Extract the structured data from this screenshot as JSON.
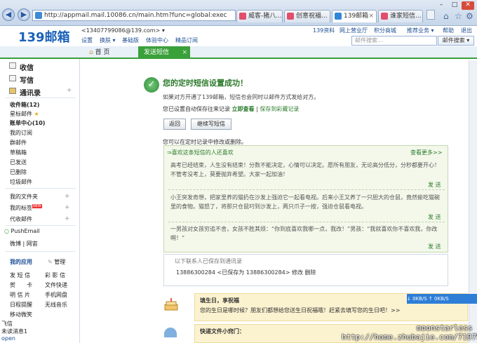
{
  "browser": {
    "url": "http://appmail.mail.10086.cn/main.htm?func=global:exec",
    "tabs": [
      "威客-猪八...",
      "创意祝福...",
      "139邮箱",
      "谁家短信..."
    ]
  },
  "header": {
    "logo": "139邮箱",
    "account": "<13407799086@139.com> ▾",
    "top_links": [
      "139资料",
      "网上营业厅",
      "积分商城",
      "推荐业务 ▾",
      "帮助",
      "退出"
    ],
    "sub_links": [
      "设置",
      "换肤 ▾",
      "基础版",
      "体验中心",
      "精品订阅"
    ],
    "search_placeholder": "邮件搜索...",
    "search_button": "邮件搜索 ▾"
  },
  "tabs": {
    "home": "首 页",
    "sent": "发送短信"
  },
  "sidebar": {
    "main": [
      "收信",
      "写信",
      "通讯录"
    ],
    "folders": [
      {
        "label": "收件箱(12)",
        "bold": true
      },
      {
        "label": "星标邮件",
        "bold": false
      },
      {
        "label": "账单中心(10)",
        "bold": true
      },
      {
        "label": "我的订阅",
        "bold": false
      },
      {
        "label": "群邮件",
        "bold": false
      },
      {
        "label": "草稿箱",
        "bold": false
      },
      {
        "label": "已发送",
        "bold": false
      },
      {
        "label": "已删除",
        "bold": false
      },
      {
        "label": "垃圾邮件",
        "bold": false
      }
    ],
    "groups": [
      "我的文件夹",
      "我的标签",
      "代收邮件"
    ],
    "new_badge": "NEW",
    "pushemail": "PushEmail",
    "weibo": "微博 | 网宙",
    "apps_title": "我的应用",
    "apps_manage": "管理",
    "apps": [
      "发 短 信",
      "彩 影 信",
      "贺　　卡",
      "文件快递",
      "明 信 片",
      "手机网盘",
      "日程提醒",
      "无线音乐",
      "移动微笑"
    ],
    "bottom": [
      "飞信",
      "未读消息1",
      "open"
    ]
  },
  "content": {
    "title": "您的定时短信设置成功！",
    "desc": "如果对方开通了139邮箱，短信也会同时以邮件方式发给对方。",
    "autosave": "您已设置自动保存往来记录",
    "view_now": "立即查看",
    "save_to_favorites": "保存到彩藏记录",
    "back_button": "返回",
    "continue_button": "继续写短信",
    "edit_hint": "您可以在定时记录中修改或删除。",
    "greeting_title": "⇒喜欢这条短信的人还喜欢",
    "view_more": "查看更多>>",
    "messages": [
      "高考已经结束，人生没有结束！分数不能决定，心情可以决定。愿所有朋友，无论高分低分，分秒都要开心！不管考没考上，莫要抛弃希望。大家一起加油！",
      "小王突发奇想，把家里养的猫扔在沙发上强迫它一起看电视。后来小王又养了一只胆大的仓鼠，竟然偷吃猫碗里的食物。猫怒了，将那只仓鼠叼到沙发上，两只爪子一按，强迫仓鼠看电视。",
      "一男孩对女孩穷追不舍，女孩不胜其烦：“你到底喜欢我哪一点，我改！”男孩：“我就喜欢你不喜欢我，你改啊！”"
    ],
    "send_label": "发 送",
    "contacts_title": "以下联系人已保存到通讯录",
    "contact_entry": "13886300284 <已保存为 13886300284> 修改 删除",
    "promo_title": "填生日，享祝福",
    "promo_text": "您的生日是哪时候？朋友们都想给您送生日祝福哦！赶紧去填写您的生日吧！>>",
    "promo2_title": "快递文件小窍门：",
    "speed": "↓ 0KB/S  ↑ 0KB/S"
  },
  "watermark": [
    "moonstarless",
    "http://home.zhubajie.com/7197573/"
  ],
  "colors": {
    "accent_green": "#3aa03a",
    "link_blue": "#1c4f95"
  }
}
